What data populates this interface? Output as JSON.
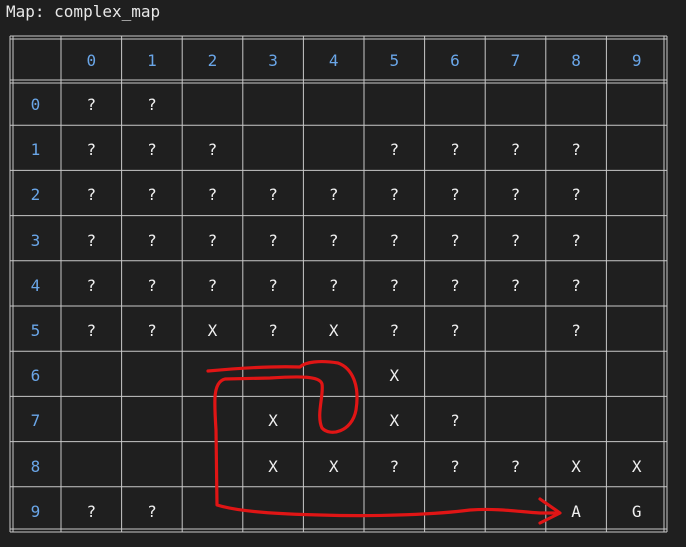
{
  "terminal": {
    "title": "Map: complex_map"
  },
  "grid": {
    "column_headers": [
      "0",
      "1",
      "2",
      "3",
      "4",
      "5",
      "6",
      "7",
      "8",
      "9"
    ],
    "row_headers": [
      "0",
      "1",
      "2",
      "3",
      "4",
      "5",
      "6",
      "7",
      "8",
      "9"
    ],
    "cells": [
      [
        "?",
        "?",
        "",
        "",
        "",
        "",
        "",
        "",
        "",
        ""
      ],
      [
        "?",
        "?",
        "?",
        "",
        "",
        "?",
        "?",
        "?",
        "?",
        ""
      ],
      [
        "?",
        "?",
        "?",
        "?",
        "?",
        "?",
        "?",
        "?",
        "?",
        ""
      ],
      [
        "?",
        "?",
        "?",
        "?",
        "?",
        "?",
        "?",
        "?",
        "?",
        ""
      ],
      [
        "?",
        "?",
        "?",
        "?",
        "?",
        "?",
        "?",
        "?",
        "?",
        ""
      ],
      [
        "?",
        "?",
        "X",
        "?",
        "X",
        "?",
        "?",
        "",
        "?",
        ""
      ],
      [
        "",
        "",
        "",
        "",
        "",
        "X",
        "",
        "",
        "",
        ""
      ],
      [
        "",
        "",
        "",
        "X",
        "",
        "X",
        "?",
        "",
        "",
        ""
      ],
      [
        "",
        "",
        "",
        "X",
        "X",
        "?",
        "?",
        "?",
        "X",
        "X"
      ],
      [
        "?",
        "?",
        "",
        "",
        "",
        "",
        "",
        "",
        "A",
        "G"
      ]
    ]
  },
  "annotation": {
    "color": "#e01515",
    "arrow_target": "A"
  }
}
